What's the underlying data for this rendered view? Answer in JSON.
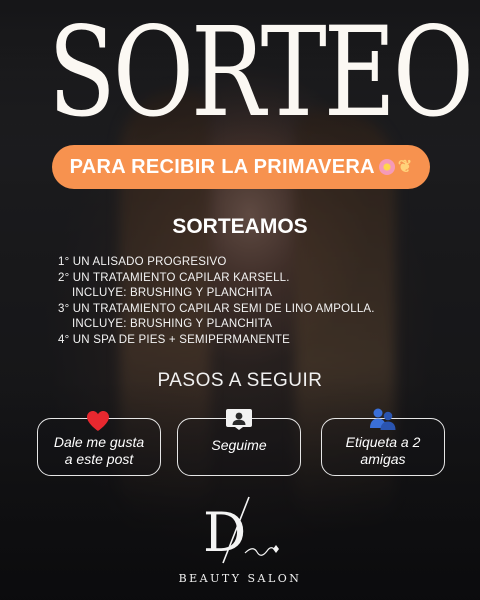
{
  "header": {
    "title": "SORTEO",
    "banner_text": "PARA RECIBIR LA PRIMAVERA",
    "banner_icons": [
      "flower-icon",
      "bouquet-icon"
    ],
    "banner_color": "#f7924f"
  },
  "prizes": {
    "heading": "SORTEAMOS",
    "items": [
      "1° UN ALISADO PROGRESIVO",
      "2° UN TRATAMIENTO CAPILAR KARSELL.",
      "INCLUYE: BRUSHING Y PLANCHITA",
      "3° UN TRATAMIENTO CAPILAR SEMI DE LINO AMPOLLA.",
      "INCLUYE: BRUSHING Y PLANCHITA",
      "4° UN SPA DE PIES + SEMIPERMANENTE"
    ]
  },
  "steps": {
    "heading": "PASOS A SEGUIR",
    "items": [
      {
        "icon": "heart-icon",
        "label": "Dale me gusta a este post"
      },
      {
        "icon": "person-icon",
        "label": "Seguime"
      },
      {
        "icon": "people-icon",
        "label": "Etiqueta a 2 amigas"
      }
    ]
  },
  "brand": {
    "logo_letter": "D",
    "name": "BEAUTY SALON"
  },
  "colors": {
    "heart": "#e8282f",
    "people": "#2f5fc4",
    "text": "#ffffff"
  }
}
